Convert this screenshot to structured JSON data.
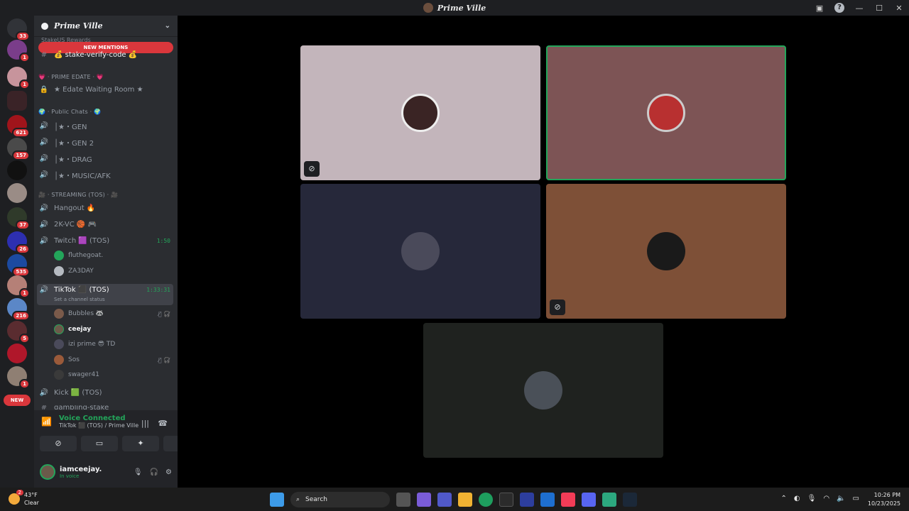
{
  "window": {
    "title": "Prime Ville",
    "controls": [
      "—",
      "☐",
      "✕"
    ]
  },
  "servers": {
    "badges": [
      "33",
      "1",
      "1",
      "621",
      "157",
      "37",
      "26",
      "535",
      "1",
      "216",
      "5",
      "1"
    ],
    "new_label": "NEW"
  },
  "sidebar": {
    "guild_name": "Prime Ville",
    "stake_text": "StakeUS Rewards",
    "new_mentions": "NEW MENTIONS",
    "channels": {
      "verify": "💰 stake-verify-code 💰",
      "cat_edate": "💗 · PRIME EDATE · 💗",
      "edate_room": "★ Edate Waiting Room ★",
      "cat_public": "🌍 · Public Chats · 🌍",
      "gen": "│★・GEN",
      "gen2": "│★・GEN 2",
      "drag": "│★・DRAG",
      "music": "│★・MUSIC/AFK",
      "cat_streaming": "🎥 · STREAMING (TOS) · 🎥",
      "hangout": "Hangout 🔥",
      "vc2k": "2K-VC 🏀 🎮",
      "twitch": "Twitch 🟪 (TOS)",
      "twitch_time": "1:50",
      "tiktok": "TikTok ⬛ (TOS)",
      "tiktok_time": "1:33:31",
      "tiktok_status": "Set a channel status",
      "kick": "Kick 🟩 (TOS)",
      "gambling": "gambling-stake"
    },
    "twitch_users": [
      "fluthegoat.",
      "ZA3DAY"
    ],
    "tiktok_users": [
      {
        "name": "Bubbles 🦝",
        "status": "🎙̸ 🎧̸"
      },
      {
        "name": "ceejay",
        "status": ""
      },
      {
        "name": "izi prime 😎 TD",
        "status": ""
      },
      {
        "name": "Sos",
        "status": "🎙̸ 🎧̸"
      },
      {
        "name": "swager41",
        "status": ""
      }
    ]
  },
  "voice": {
    "connected": "Voice Connected",
    "location": "TikTok ⬛ (TOS) / Prime Ville",
    "username": "iamceejay.",
    "status": "In voice"
  },
  "tiles": [
    {
      "bg": "#c3b5bb",
      "camera_off": true
    },
    {
      "bg": "#7d5455",
      "camera_off": false
    },
    {
      "bg": "#26283a",
      "camera_off": false
    },
    {
      "bg": "#7e5037",
      "camera_off": true
    },
    {
      "bg": "#1f221f",
      "camera_off": false
    }
  ],
  "taskbar": {
    "weather_badge": "2",
    "temp": "43°F",
    "condition": "Clear",
    "search": "Search",
    "time": "10:26 PM",
    "date": "10/23/2025"
  }
}
